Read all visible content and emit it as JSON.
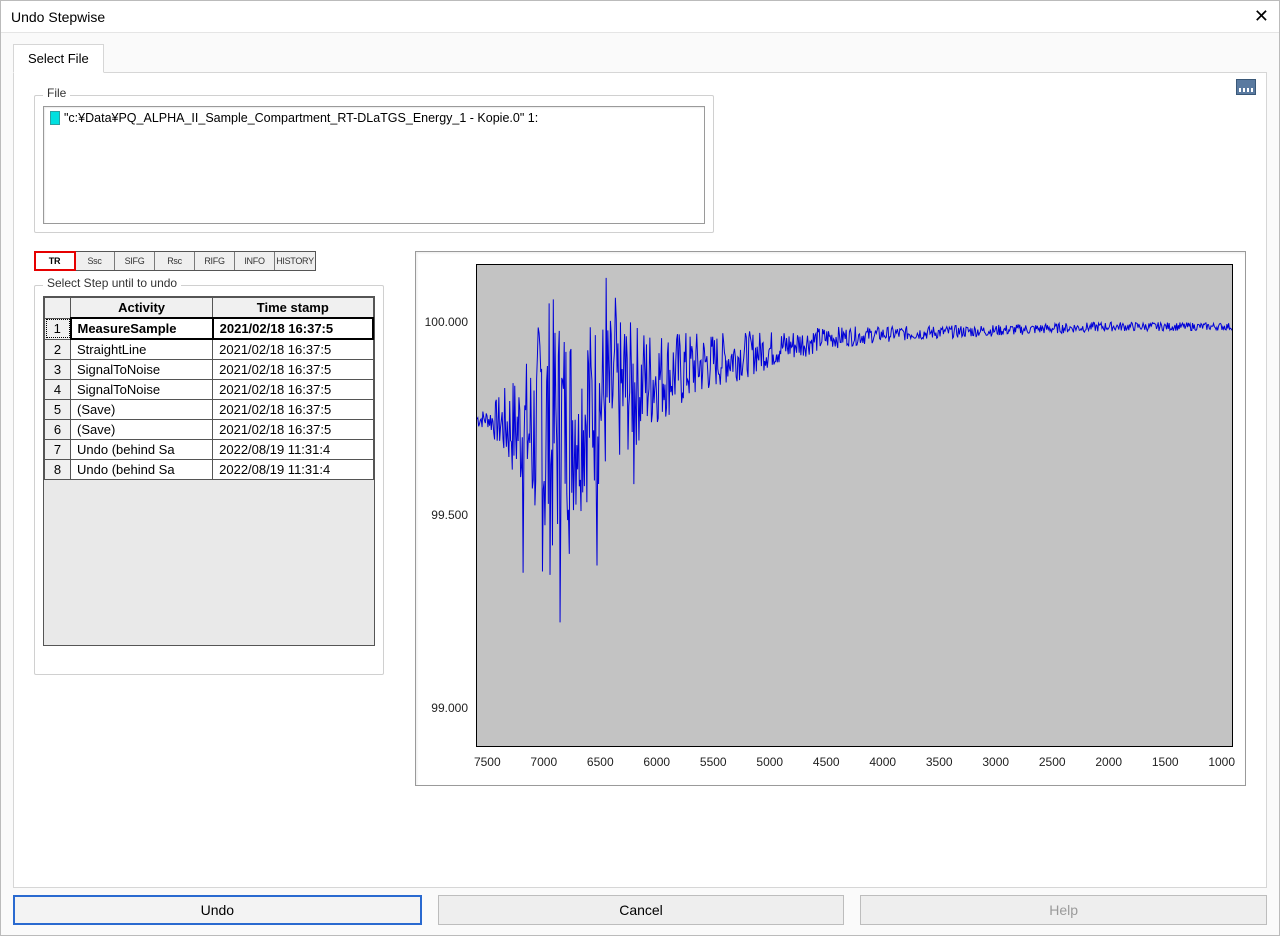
{
  "window": {
    "title": "Undo Stepwise"
  },
  "tabs": {
    "select_file": "Select File"
  },
  "file_group": {
    "legend": "File",
    "items": [
      "\"c:¥Data¥PQ_ALPHA_II_Sample_Compartment_RT-DLaTGS_Energy_1 - Kopie.0\" 1:"
    ]
  },
  "datablock_tabs": [
    "TR",
    "Ssc",
    "SIFG",
    "Rsc",
    "RIFG",
    "INFO",
    "HISTORY"
  ],
  "datablock_selected_index": 0,
  "steps_group": {
    "legend": "Select Step until to undo",
    "headers": {
      "row": "",
      "activity": "Activity",
      "ts": "Time stamp"
    },
    "rows": [
      {
        "n": "1",
        "activity": "MeasureSample",
        "ts": "2021/02/18 16:37:5"
      },
      {
        "n": "2",
        "activity": "StraightLine",
        "ts": "2021/02/18 16:37:5"
      },
      {
        "n": "3",
        "activity": "SignalToNoise",
        "ts": "2021/02/18 16:37:5"
      },
      {
        "n": "4",
        "activity": "SignalToNoise",
        "ts": "2021/02/18 16:37:5"
      },
      {
        "n": "5",
        "activity": "(Save)",
        "ts": "2021/02/18 16:37:5"
      },
      {
        "n": "6",
        "activity": "(Save)",
        "ts": "2021/02/18 16:37:5"
      },
      {
        "n": "7",
        "activity": "Undo (behind Sa",
        "ts": "2022/08/19 11:31:4"
      },
      {
        "n": "8",
        "activity": "Undo (behind Sa",
        "ts": "2022/08/19 11:31:4"
      }
    ],
    "selected_index": 0
  },
  "chart_data": {
    "type": "line",
    "x_range": [
      7600,
      900
    ],
    "y_range": [
      98.9,
      100.15
    ],
    "x_ticks": [
      7500,
      7000,
      6500,
      6000,
      5500,
      5000,
      4500,
      4000,
      3500,
      3000,
      2500,
      2000,
      1500,
      1000
    ],
    "y_ticks": [
      {
        "value": 99.0,
        "label": "99.000"
      },
      {
        "value": 99.5,
        "label": "99.500"
      },
      {
        "value": 100.0,
        "label": "100.000"
      }
    ],
    "series": [
      {
        "name": "spectrum",
        "color": "#0000d8",
        "baseline": 99.98,
        "noise_envelope": [
          {
            "x": 7500,
            "amp": 0.05
          },
          {
            "x": 7100,
            "amp": 0.45
          },
          {
            "x": 7000,
            "amp": 0.8
          },
          {
            "x": 6800,
            "amp": 0.55
          },
          {
            "x": 6500,
            "amp": 0.45
          },
          {
            "x": 6000,
            "amp": 0.25
          },
          {
            "x": 5500,
            "amp": 0.15
          },
          {
            "x": 5000,
            "amp": 0.1
          },
          {
            "x": 4500,
            "amp": 0.06
          },
          {
            "x": 4000,
            "amp": 0.04
          },
          {
            "x": 3000,
            "amp": 0.03
          },
          {
            "x": 1000,
            "amp": 0.02
          }
        ],
        "baseline_drift": [
          {
            "x": 7500,
            "y": 99.75
          },
          {
            "x": 7000,
            "y": 99.7
          },
          {
            "x": 6500,
            "y": 99.8
          },
          {
            "x": 6000,
            "y": 99.86
          },
          {
            "x": 5500,
            "y": 99.9
          },
          {
            "x": 5000,
            "y": 99.93
          },
          {
            "x": 4500,
            "y": 99.96
          },
          {
            "x": 4000,
            "y": 99.97
          },
          {
            "x": 3000,
            "y": 99.98
          },
          {
            "x": 2000,
            "y": 99.99
          },
          {
            "x": 1000,
            "y": 99.99
          }
        ]
      }
    ]
  },
  "buttons": {
    "undo": "Undo",
    "cancel": "Cancel",
    "help": "Help"
  }
}
